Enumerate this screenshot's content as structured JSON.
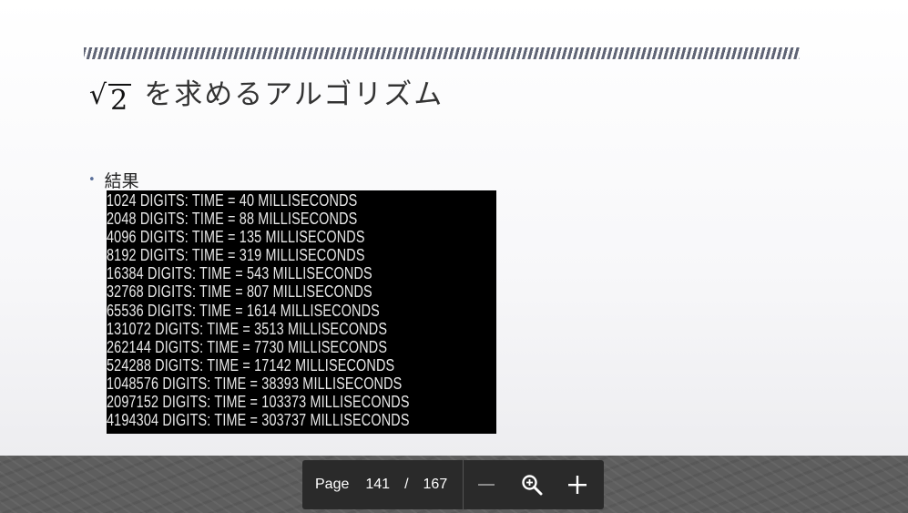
{
  "slide": {
    "title_radicand": "2",
    "title_text": "を求めるアルゴリズム",
    "bullet_label": "結果",
    "console_lines": [
      "1024 DIGITS: TIME = 40 MILLISECONDS",
      "2048 DIGITS: TIME = 88 MILLISECONDS",
      "4096 DIGITS: TIME = 135 MILLISECONDS",
      "8192 DIGITS: TIME = 319 MILLISECONDS",
      "16384 DIGITS: TIME = 543 MILLISECONDS",
      "32768 DIGITS: TIME = 807 MILLISECONDS",
      "65536 DIGITS: TIME = 1614 MILLISECONDS",
      "131072 DIGITS: TIME = 3513 MILLISECONDS",
      "262144 DIGITS: TIME = 7730 MILLISECONDS",
      "524288 DIGITS: TIME = 17142 MILLISECONDS",
      "1048576 DIGITS: TIME = 38393 MILLISECONDS",
      "2097152 DIGITS: TIME = 103373 MILLISECONDS",
      "4194304 DIGITS: TIME = 303737 MILLISECONDS"
    ]
  },
  "toolbar": {
    "page_label": "Page",
    "current_page": "141",
    "separator": "/",
    "total_pages": "167",
    "icons": {
      "zoom_out": "minus-icon",
      "zoom_fit": "zoom-magnifier-icon",
      "zoom_in": "plus-icon"
    }
  },
  "colors": {
    "toolbar_bg": "#2a2a2a",
    "console_bg": "#000000",
    "console_text": "#e8e8e8",
    "bullet": "#5a6f9a",
    "deco_bar": "#5f6475"
  }
}
